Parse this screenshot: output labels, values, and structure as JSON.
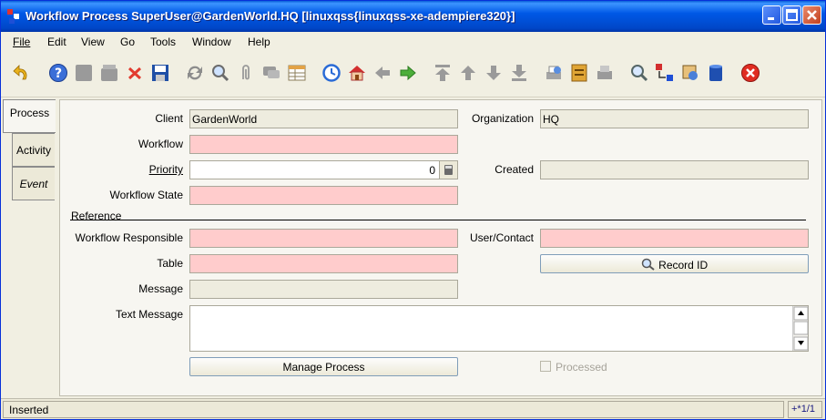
{
  "window": {
    "title": "Workflow Process  SuperUser@GardenWorld.HQ [linuxqss{linuxqss-xe-adempiere320}]"
  },
  "menu": {
    "file": "File",
    "edit": "Edit",
    "view": "View",
    "go": "Go",
    "tools": "Tools",
    "window": "Window",
    "help": "Help"
  },
  "toolbar_icons": [
    "undo-icon",
    "help-icon",
    "new-record-icon",
    "copy-record-icon",
    "delete-icon",
    "save-icon",
    "refresh-icon",
    "find-icon",
    "attachment-icon",
    "chat-icon",
    "grid-toggle-icon",
    "history-icon",
    "home-icon",
    "parent-record-icon",
    "detail-record-icon",
    "first-record-icon",
    "previous-record-icon",
    "next-record-icon",
    "last-record-icon",
    "report-icon",
    "archive-icon",
    "print-icon",
    "zoom-across-icon",
    "active-workflows-icon",
    "requests-icon",
    "product-info-icon",
    "exit-icon"
  ],
  "tabs": {
    "process": "Process",
    "activity": "Activity",
    "event": "Event"
  },
  "form": {
    "client_label": "Client",
    "client_value": "GardenWorld",
    "organization_label": "Organization",
    "organization_value": "HQ",
    "workflow_label": "Workflow",
    "workflow_value": "",
    "priority_label": "Priority",
    "priority_value": "0",
    "created_label": "Created",
    "created_value": "",
    "workflow_state_label": "Workflow State",
    "workflow_state_value": "",
    "reference_label": "Reference",
    "workflow_responsible_label": "Workflow Responsible",
    "workflow_responsible_value": "",
    "user_contact_label": "User/Contact",
    "user_contact_value": "",
    "table_label": "Table",
    "table_value": "",
    "record_id_button": "Record ID",
    "message_label": "Message",
    "message_value": "",
    "text_message_label": "Text Message",
    "text_message_value": "",
    "manage_process_button": "Manage Process",
    "processed_label": "Processed",
    "processed_checked": false
  },
  "status": {
    "message": "Inserted",
    "record_nav": "+*1/1"
  },
  "colors": {
    "titlebar": "#0058e6",
    "mandatory_field": "#ffcccc",
    "readonly_field": "#eeecdf"
  }
}
